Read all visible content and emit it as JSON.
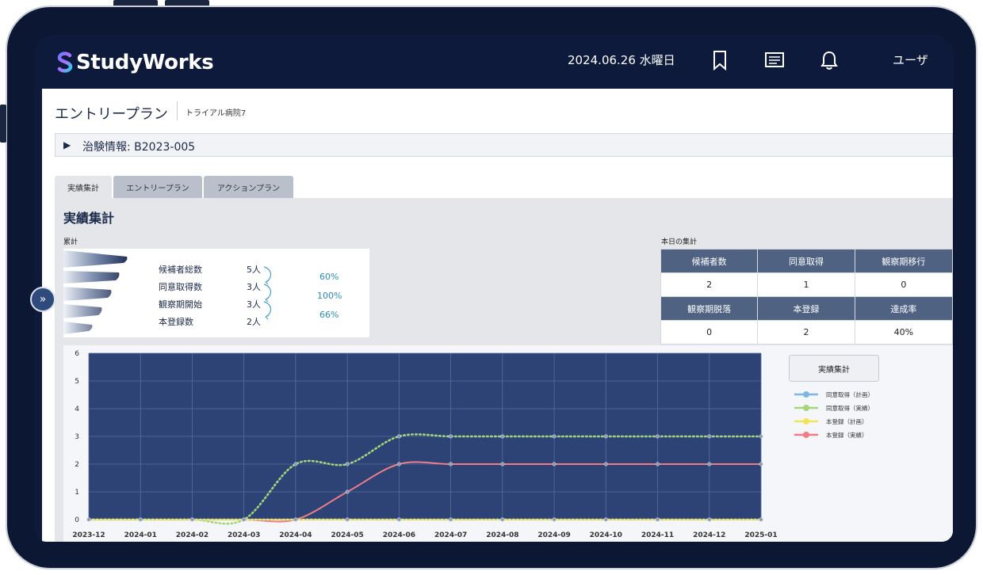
{
  "app": {
    "logo_text": "StudyWorks",
    "date": "2024.06.26 水曜日",
    "user_label": "ユーザ"
  },
  "page": {
    "title": "エントリープラン",
    "clinic": "トライアル病院7",
    "trial_label": "治験情報: B2023-005"
  },
  "tabs": [
    {
      "label": "実績集計",
      "active": true
    },
    {
      "label": "エントリープラン",
      "active": false
    },
    {
      "label": "アクションプラン",
      "active": false
    }
  ],
  "summary": {
    "title": "実績集計",
    "cumulative_label": "累計",
    "funnel": [
      {
        "label": "候補者総数",
        "value": "5人"
      },
      {
        "label": "同意取得数",
        "value": "3人"
      },
      {
        "label": "観察期開始",
        "value": "3人"
      },
      {
        "label": "本登録数",
        "value": "2人"
      }
    ],
    "conversion": [
      "60%",
      "100%",
      "66%"
    ]
  },
  "today": {
    "label": "本日の集計",
    "rows": [
      [
        {
          "header": "候補者数",
          "value": "2"
        },
        {
          "header": "同意取得",
          "value": "1"
        },
        {
          "header": "観察期移行",
          "value": "0"
        }
      ],
      [
        {
          "header": "観察期脱落",
          "value": "0"
        },
        {
          "header": "本登録",
          "value": "2"
        },
        {
          "header": "達成率",
          "value": "40%"
        }
      ]
    ]
  },
  "chart_button": "実績集計",
  "colors": {
    "frame": "#0b1733",
    "topbar": "#0d1a3b",
    "plot_bg": "#2d4375",
    "table_header": "#4f6282",
    "consent_plan": "#7fb6e8",
    "consent_actual": "#a4d67a",
    "registration_plan": "#f3e35a",
    "registration_actual": "#ef7d85"
  },
  "chart_data": {
    "type": "line",
    "x": [
      "2023-12",
      "2024-01",
      "2024-02",
      "2024-03",
      "2024-04",
      "2024-05",
      "2024-06",
      "2024-07",
      "2024-08",
      "2024-09",
      "2024-10",
      "2024-11",
      "2024-12",
      "2025-01"
    ],
    "ylim": [
      0,
      6
    ],
    "yticks": [
      0,
      1,
      2,
      3,
      4,
      5,
      6
    ],
    "grid": true,
    "legend_position": "right",
    "series": [
      {
        "name": "同意取得（計画）",
        "color": "#7fb6e8",
        "values": [
          0,
          0,
          0,
          0,
          0,
          0,
          0,
          0,
          0,
          0,
          0,
          0,
          0,
          0
        ]
      },
      {
        "name": "同意取得（実績）",
        "color": "#a4d67a",
        "values": [
          0,
          0,
          0,
          0,
          2,
          2,
          3,
          3,
          3,
          3,
          3,
          3,
          3,
          3
        ]
      },
      {
        "name": "本登録（計画）",
        "color": "#f3e35a",
        "values": [
          0,
          0,
          0,
          0,
          0,
          0,
          0,
          0,
          0,
          0,
          0,
          0,
          0,
          0
        ]
      },
      {
        "name": "本登録（実績）",
        "color": "#ef7d85",
        "values": [
          0,
          0,
          0,
          0,
          0,
          1,
          2,
          2,
          2,
          2,
          2,
          2,
          2,
          2
        ]
      }
    ]
  }
}
